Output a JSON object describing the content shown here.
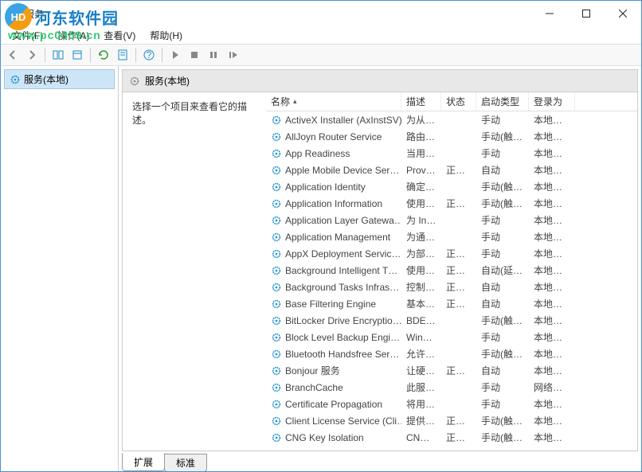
{
  "window": {
    "title": "服务"
  },
  "watermark": {
    "brand": "河东软件园",
    "url": "www.pc0359.cn",
    "logo_text": "HD"
  },
  "menu": {
    "file": "文件(F)",
    "action": "操作(A)",
    "view": "查看(V)",
    "help": "帮助(H)"
  },
  "tree": {
    "root": "服务(本地)"
  },
  "header": {
    "title": "服务(本地)"
  },
  "desc": {
    "prompt": "选择一个项目来查看它的描述。"
  },
  "columns": {
    "name": "名称",
    "desc": "描述",
    "status": "状态",
    "startup": "启动类型",
    "logon": "登录为"
  },
  "tabs": {
    "extended": "扩展",
    "standard": "标准"
  },
  "services": [
    {
      "name": "ActiveX Installer (AxInstSV)",
      "desc": "为从 …",
      "status": "",
      "startup": "手动",
      "logon": "本地系统"
    },
    {
      "name": "AllJoyn Router Service",
      "desc": "路由…",
      "status": "",
      "startup": "手动(触发…",
      "logon": "本地服务"
    },
    {
      "name": "App Readiness",
      "desc": "当用…",
      "status": "",
      "startup": "手动",
      "logon": "本地系统"
    },
    {
      "name": "Apple Mobile Device Ser…",
      "desc": "Prov…",
      "status": "正在…",
      "startup": "自动",
      "logon": "本地系统"
    },
    {
      "name": "Application Identity",
      "desc": "确定…",
      "status": "",
      "startup": "手动(触发…",
      "logon": "本地服务"
    },
    {
      "name": "Application Information",
      "desc": "使用…",
      "status": "正在…",
      "startup": "手动(触发…",
      "logon": "本地系统"
    },
    {
      "name": "Application Layer Gatewa…",
      "desc": "为 In…",
      "status": "",
      "startup": "手动",
      "logon": "本地服务"
    },
    {
      "name": "Application Management",
      "desc": "为通…",
      "status": "",
      "startup": "手动",
      "logon": "本地系统"
    },
    {
      "name": "AppX Deployment Servic…",
      "desc": "为部…",
      "status": "正在…",
      "startup": "手动",
      "logon": "本地系统"
    },
    {
      "name": "Background Intelligent T…",
      "desc": "使用…",
      "status": "正在…",
      "startup": "自动(延迟…",
      "logon": "本地系统"
    },
    {
      "name": "Background Tasks Infras…",
      "desc": "控制…",
      "status": "正在…",
      "startup": "自动",
      "logon": "本地系统"
    },
    {
      "name": "Base Filtering Engine",
      "desc": "基本…",
      "status": "正在…",
      "startup": "自动",
      "logon": "本地服务"
    },
    {
      "name": "BitLocker Drive Encryptio…",
      "desc": "BDE…",
      "status": "",
      "startup": "手动(触发…",
      "logon": "本地系统"
    },
    {
      "name": "Block Level Backup Engi…",
      "desc": "Win…",
      "status": "",
      "startup": "手动",
      "logon": "本地系统"
    },
    {
      "name": "Bluetooth Handsfree Ser…",
      "desc": "允许…",
      "status": "",
      "startup": "手动(触发…",
      "logon": "本地服务"
    },
    {
      "name": "Bonjour 服务",
      "desc": "让硬…",
      "status": "正在…",
      "startup": "自动",
      "logon": "本地系统"
    },
    {
      "name": "BranchCache",
      "desc": "此服…",
      "status": "",
      "startup": "手动",
      "logon": "网络服务"
    },
    {
      "name": "Certificate Propagation",
      "desc": "将用…",
      "status": "",
      "startup": "手动",
      "logon": "本地系统"
    },
    {
      "name": "Client License Service (Cli…",
      "desc": "提供…",
      "status": "正在…",
      "startup": "手动(触发…",
      "logon": "本地系统"
    },
    {
      "name": "CNG Key Isolation",
      "desc": "CNG…",
      "status": "正在…",
      "startup": "手动(触发…",
      "logon": "本地系统"
    }
  ]
}
